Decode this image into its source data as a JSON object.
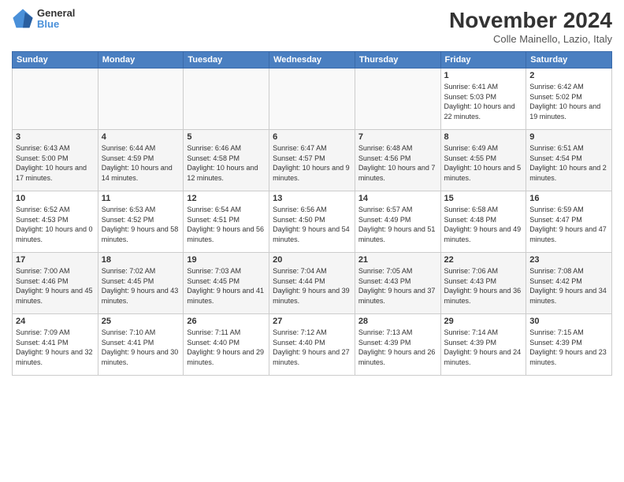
{
  "logo": {
    "general": "General",
    "blue": "Blue"
  },
  "title": "November 2024",
  "subtitle": "Colle Mainello, Lazio, Italy",
  "weekdays": [
    "Sunday",
    "Monday",
    "Tuesday",
    "Wednesday",
    "Thursday",
    "Friday",
    "Saturday"
  ],
  "weeks": [
    [
      {
        "day": "",
        "info": ""
      },
      {
        "day": "",
        "info": ""
      },
      {
        "day": "",
        "info": ""
      },
      {
        "day": "",
        "info": ""
      },
      {
        "day": "",
        "info": ""
      },
      {
        "day": "1",
        "info": "Sunrise: 6:41 AM\nSunset: 5:03 PM\nDaylight: 10 hours and 22 minutes."
      },
      {
        "day": "2",
        "info": "Sunrise: 6:42 AM\nSunset: 5:02 PM\nDaylight: 10 hours and 19 minutes."
      }
    ],
    [
      {
        "day": "3",
        "info": "Sunrise: 6:43 AM\nSunset: 5:00 PM\nDaylight: 10 hours and 17 minutes."
      },
      {
        "day": "4",
        "info": "Sunrise: 6:44 AM\nSunset: 4:59 PM\nDaylight: 10 hours and 14 minutes."
      },
      {
        "day": "5",
        "info": "Sunrise: 6:46 AM\nSunset: 4:58 PM\nDaylight: 10 hours and 12 minutes."
      },
      {
        "day": "6",
        "info": "Sunrise: 6:47 AM\nSunset: 4:57 PM\nDaylight: 10 hours and 9 minutes."
      },
      {
        "day": "7",
        "info": "Sunrise: 6:48 AM\nSunset: 4:56 PM\nDaylight: 10 hours and 7 minutes."
      },
      {
        "day": "8",
        "info": "Sunrise: 6:49 AM\nSunset: 4:55 PM\nDaylight: 10 hours and 5 minutes."
      },
      {
        "day": "9",
        "info": "Sunrise: 6:51 AM\nSunset: 4:54 PM\nDaylight: 10 hours and 2 minutes."
      }
    ],
    [
      {
        "day": "10",
        "info": "Sunrise: 6:52 AM\nSunset: 4:53 PM\nDaylight: 10 hours and 0 minutes."
      },
      {
        "day": "11",
        "info": "Sunrise: 6:53 AM\nSunset: 4:52 PM\nDaylight: 9 hours and 58 minutes."
      },
      {
        "day": "12",
        "info": "Sunrise: 6:54 AM\nSunset: 4:51 PM\nDaylight: 9 hours and 56 minutes."
      },
      {
        "day": "13",
        "info": "Sunrise: 6:56 AM\nSunset: 4:50 PM\nDaylight: 9 hours and 54 minutes."
      },
      {
        "day": "14",
        "info": "Sunrise: 6:57 AM\nSunset: 4:49 PM\nDaylight: 9 hours and 51 minutes."
      },
      {
        "day": "15",
        "info": "Sunrise: 6:58 AM\nSunset: 4:48 PM\nDaylight: 9 hours and 49 minutes."
      },
      {
        "day": "16",
        "info": "Sunrise: 6:59 AM\nSunset: 4:47 PM\nDaylight: 9 hours and 47 minutes."
      }
    ],
    [
      {
        "day": "17",
        "info": "Sunrise: 7:00 AM\nSunset: 4:46 PM\nDaylight: 9 hours and 45 minutes."
      },
      {
        "day": "18",
        "info": "Sunrise: 7:02 AM\nSunset: 4:45 PM\nDaylight: 9 hours and 43 minutes."
      },
      {
        "day": "19",
        "info": "Sunrise: 7:03 AM\nSunset: 4:45 PM\nDaylight: 9 hours and 41 minutes."
      },
      {
        "day": "20",
        "info": "Sunrise: 7:04 AM\nSunset: 4:44 PM\nDaylight: 9 hours and 39 minutes."
      },
      {
        "day": "21",
        "info": "Sunrise: 7:05 AM\nSunset: 4:43 PM\nDaylight: 9 hours and 37 minutes."
      },
      {
        "day": "22",
        "info": "Sunrise: 7:06 AM\nSunset: 4:43 PM\nDaylight: 9 hours and 36 minutes."
      },
      {
        "day": "23",
        "info": "Sunrise: 7:08 AM\nSunset: 4:42 PM\nDaylight: 9 hours and 34 minutes."
      }
    ],
    [
      {
        "day": "24",
        "info": "Sunrise: 7:09 AM\nSunset: 4:41 PM\nDaylight: 9 hours and 32 minutes."
      },
      {
        "day": "25",
        "info": "Sunrise: 7:10 AM\nSunset: 4:41 PM\nDaylight: 9 hours and 30 minutes."
      },
      {
        "day": "26",
        "info": "Sunrise: 7:11 AM\nSunset: 4:40 PM\nDaylight: 9 hours and 29 minutes."
      },
      {
        "day": "27",
        "info": "Sunrise: 7:12 AM\nSunset: 4:40 PM\nDaylight: 9 hours and 27 minutes."
      },
      {
        "day": "28",
        "info": "Sunrise: 7:13 AM\nSunset: 4:39 PM\nDaylight: 9 hours and 26 minutes."
      },
      {
        "day": "29",
        "info": "Sunrise: 7:14 AM\nSunset: 4:39 PM\nDaylight: 9 hours and 24 minutes."
      },
      {
        "day": "30",
        "info": "Sunrise: 7:15 AM\nSunset: 4:39 PM\nDaylight: 9 hours and 23 minutes."
      }
    ]
  ]
}
